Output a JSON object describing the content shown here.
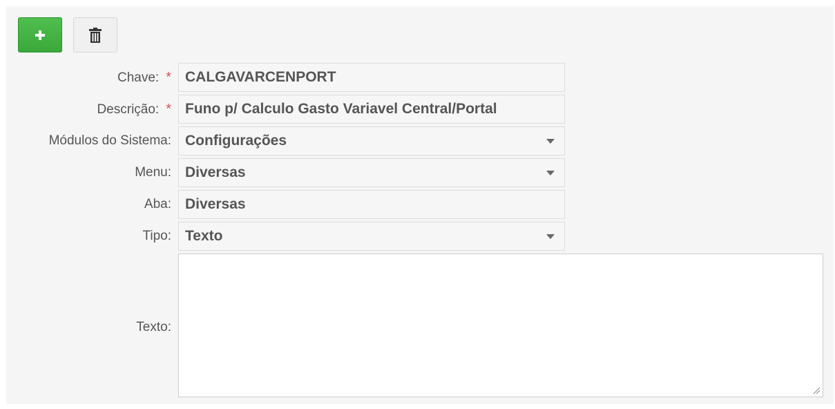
{
  "toolbar": {
    "add_icon": "plus-icon",
    "delete_icon": "trash-icon",
    "colors": {
      "add": "#44b544",
      "delete_bg": "#f0f0f0"
    }
  },
  "form": {
    "chave": {
      "label": "Chave:",
      "required_mark": "*",
      "value": "CALGAVARCENPORT"
    },
    "descricao": {
      "label": "Descrição:",
      "required_mark": "*",
      "value": "Funo p/ Calculo Gasto Variavel Central/Portal"
    },
    "modulos": {
      "label": "Módulos do Sistema:",
      "value": "Configurações"
    },
    "menu": {
      "label": "Menu:",
      "value": "Diversas"
    },
    "aba": {
      "label": "Aba:",
      "value": "Diversas"
    },
    "tipo": {
      "label": "Tipo:",
      "value": "Texto"
    },
    "texto": {
      "label": "Texto:",
      "value": ""
    }
  },
  "colors": {
    "required": "#d9534f",
    "label": "#555555"
  }
}
